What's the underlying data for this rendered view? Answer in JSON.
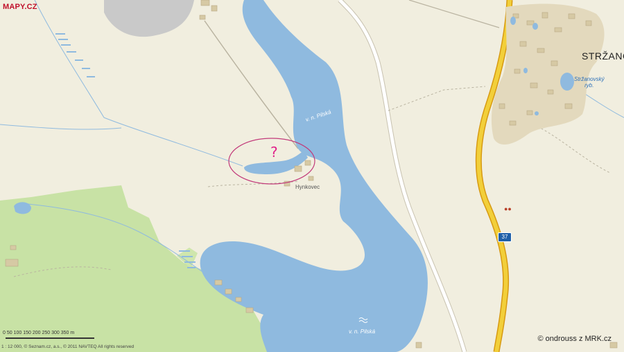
{
  "logo": {
    "text": "MAPY.CZ"
  },
  "labels": {
    "water_upper": "v. n. Pilská",
    "water_lower": "v. n. Pilská",
    "town": "STRŽANO",
    "hamlet": "Hynkovec",
    "pond_line1": "Stržanovský",
    "pond_line2": "ryb.",
    "road_shield": "37",
    "question_mark": "?"
  },
  "scale": {
    "ticks": "0 50 100 150 200 250 300 350 m",
    "ratio": "1 : 12 000, © Seznam.cz, a.s., © 2011 NAVTEQ All rights reserved"
  },
  "attribution": "© ondrouss z MRK.cz",
  "colors": {
    "land": "#f1eedf",
    "water": "#8fbadf",
    "forest": "#c8e2a5",
    "road_main": "#f2cf3a",
    "road_border": "#d79a12",
    "built_up": "#e3d9bd",
    "highlight_ellipse": "#c23a7a",
    "question_mark": "#e0218a"
  },
  "icons": {
    "water_symbol": "waves-icon",
    "poi": "footprints-icon"
  }
}
